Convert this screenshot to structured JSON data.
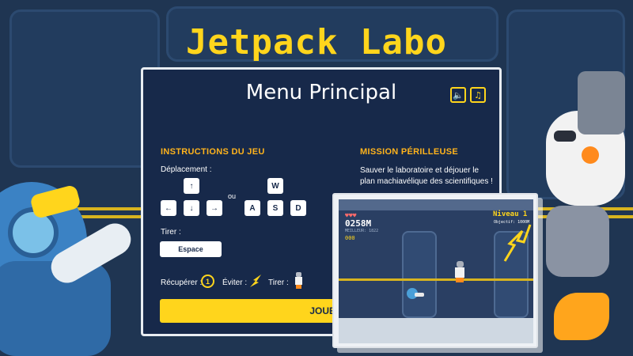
{
  "game": {
    "title": "Jetpack Labo"
  },
  "menu": {
    "title": "Menu Principal",
    "sound_icon": "speaker-icon",
    "music_icon": "music-note-icon",
    "instructions": {
      "title": "INSTRUCTIONS DU JEU",
      "move_label": "Déplacement :",
      "arrow_keys": [
        "↑",
        "←",
        "↓",
        "→"
      ],
      "or_label": "ou",
      "letter_keys": [
        "W",
        "A",
        "S",
        "D"
      ],
      "shoot_label": "Tirer :",
      "shoot_key": "Espace",
      "collect_label": "Récupérer :",
      "collect_value": "1",
      "avoid_label": "Éviter :",
      "target_label": "Tirer :"
    },
    "mission": {
      "title": "MISSION PÉRILLEUSE",
      "text": "Sauver le laboratoire et déjouer le plan machiavélique des scientifiques !"
    },
    "play_button": "JOUER"
  },
  "preview": {
    "distance": "0258M",
    "best": "MEILLEUR: 1822",
    "coins": "000",
    "level": "Niveau 1",
    "objective": "Objectif: 1000M"
  },
  "colors": {
    "accent": "#ffd51c",
    "orange": "#ffb31c",
    "panel": "#17294a",
    "background": "#1f3552"
  }
}
